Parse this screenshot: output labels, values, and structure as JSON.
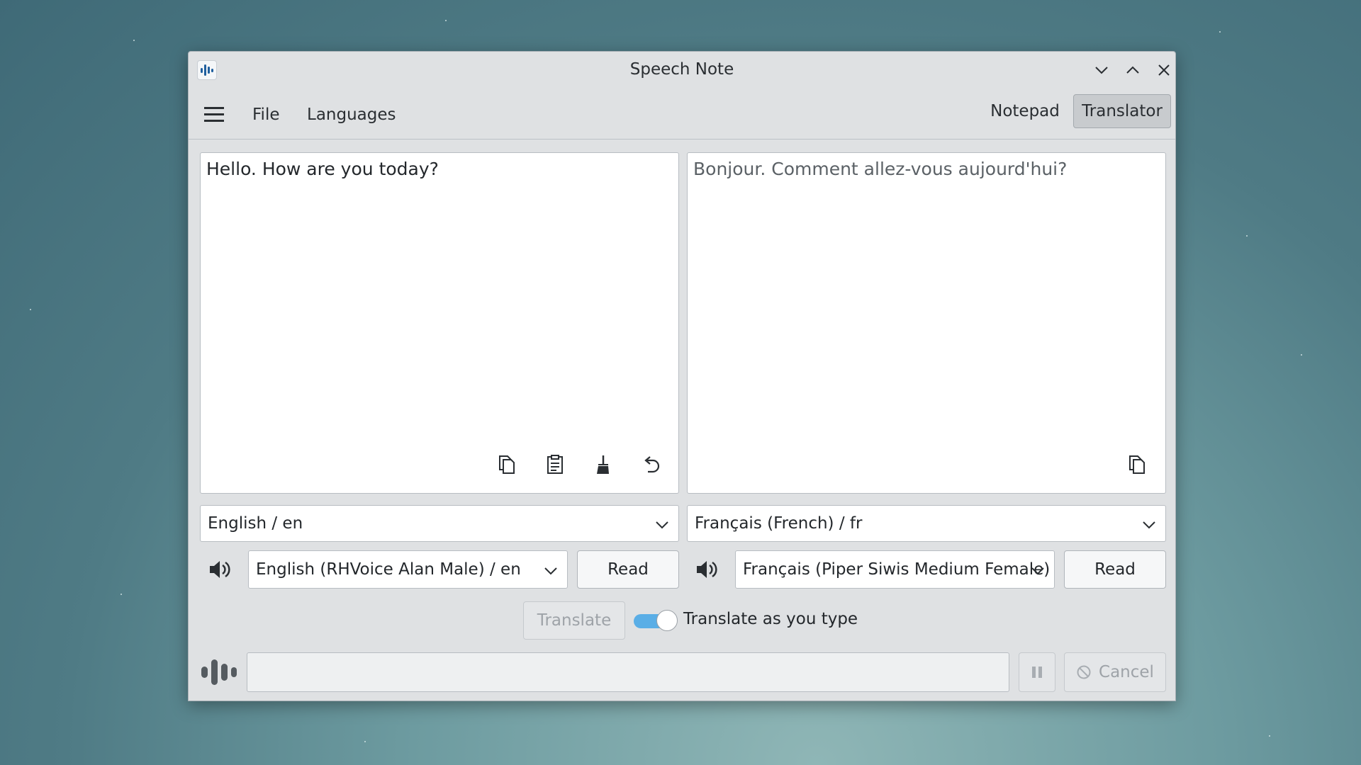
{
  "window": {
    "title": "Speech Note"
  },
  "menu": {
    "file": "File",
    "languages": "Languages"
  },
  "modes": {
    "notepad": "Notepad",
    "translator": "Translator"
  },
  "source": {
    "text": "Hello. How are you today?",
    "language": "English / en",
    "voice": "English (RHVoice Alan Male) / en",
    "read_label": "Read"
  },
  "target": {
    "text": "Bonjour. Comment allez-vous aujourd'hui?",
    "language": "Français (French) / fr",
    "voice": "Français (Piper Siwis Medium Female) …",
    "read_label": "Read"
  },
  "actions": {
    "translate_label": "Translate",
    "translate_as_you_type_label": "Translate as you type",
    "translate_as_you_type_on": true,
    "cancel_label": "Cancel"
  },
  "colors": {
    "accent": "#5aaee6",
    "app_icon": "#1f5f9e"
  }
}
